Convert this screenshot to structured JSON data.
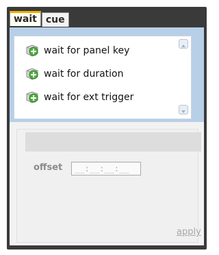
{
  "tabs": [
    {
      "label": "wait",
      "active": true
    },
    {
      "label": "cue",
      "active": false
    }
  ],
  "list": {
    "items": [
      {
        "label": "wait for panel key",
        "icon": "green-plus-puzzle-icon"
      },
      {
        "label": "wait for duration",
        "icon": "green-plus-puzzle-icon"
      },
      {
        "label": "wait for ext trigger",
        "icon": "green-plus-puzzle-icon"
      }
    ]
  },
  "form": {
    "offset_label": "offset",
    "offset_placeholder": "__:__:__:__"
  },
  "actions": {
    "apply_label": "apply"
  },
  "colors": {
    "frame": "#3a3a3a",
    "active_tab_accent": "#f0b000",
    "list_panel": "#b8cfe8",
    "bottom_panel": "#f2f2f2"
  }
}
